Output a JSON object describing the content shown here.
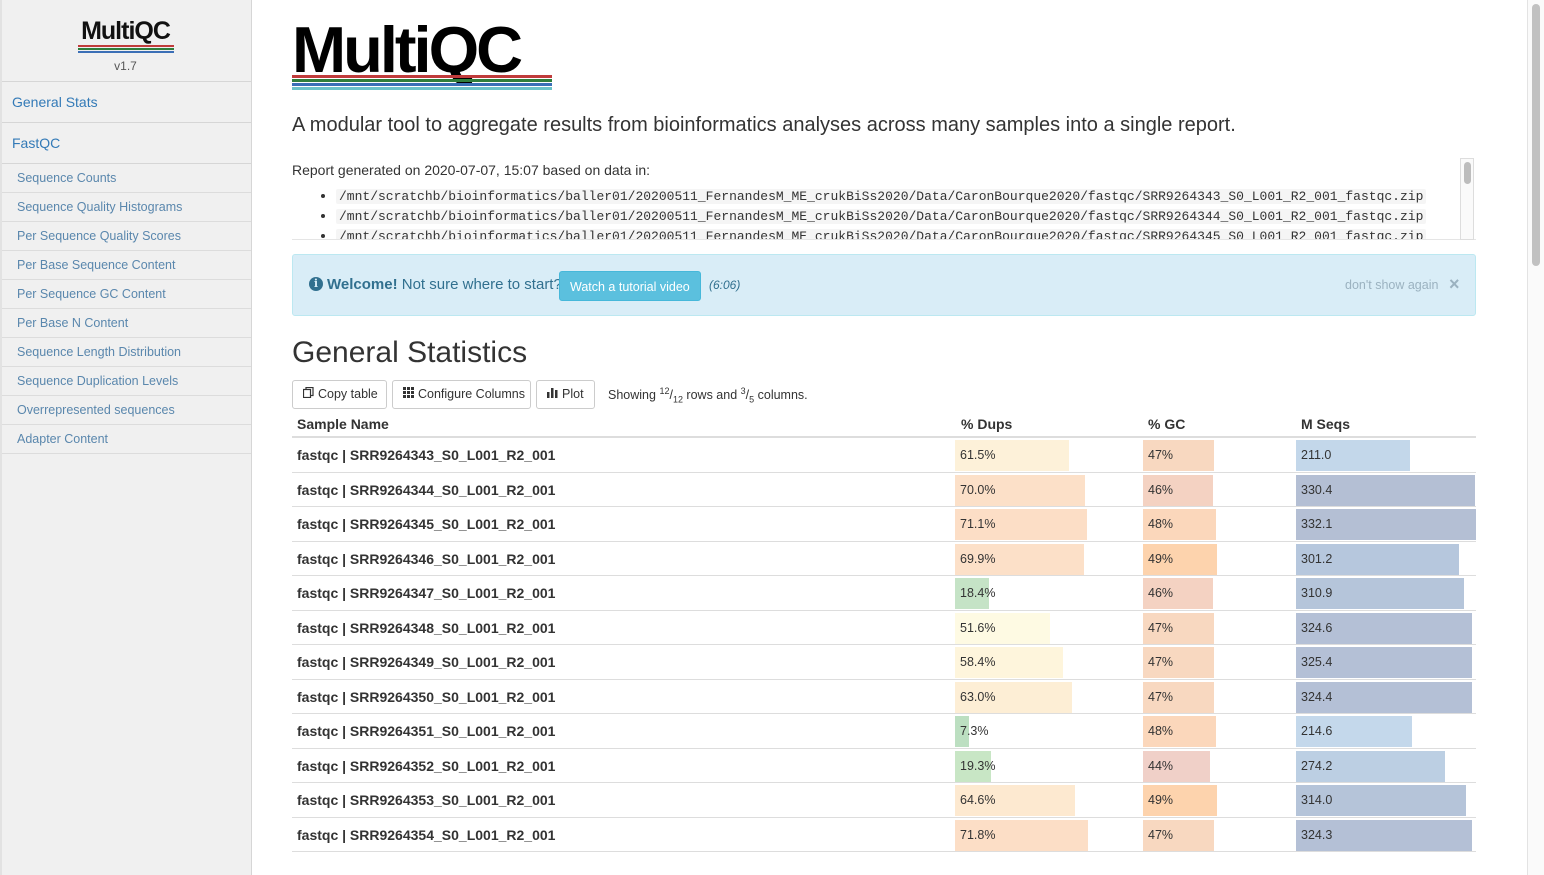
{
  "app": {
    "logo_text": "MultiQC",
    "version": "v1.7",
    "logo_line_colors": [
      "#c03b3b",
      "#2f7e3c",
      "#3b6fb6",
      "#6bc2c8"
    ]
  },
  "sidebar": {
    "general_stats": "General Stats",
    "fastqc": "FastQC",
    "fastqc_items": [
      "Sequence Counts",
      "Sequence Quality Histograms",
      "Per Sequence Quality Scores",
      "Per Base Sequence Content",
      "Per Sequence GC Content",
      "Per Base N Content",
      "Sequence Length Distribution",
      "Sequence Duplication Levels",
      "Overrepresented sequences",
      "Adapter Content"
    ]
  },
  "intro": {
    "tagline": "A modular tool to aggregate results from bioinformatics analyses across many samples into a single report.",
    "generated": "Report generated on 2020-07-07, 15:07 based on data in:",
    "files": [
      "/mnt/scratchb/bioinformatics/baller01/20200511_FernandesM_ME_crukBiSs2020/Data/CaronBourque2020/fastqc/SRR9264343_S0_L001_R2_001_fastqc.zip",
      "/mnt/scratchb/bioinformatics/baller01/20200511_FernandesM_ME_crukBiSs2020/Data/CaronBourque2020/fastqc/SRR9264344_S0_L001_R2_001_fastqc.zip",
      "/mnt/scratchb/bioinformatics/baller01/20200511_FernandesM_ME_crukBiSs2020/Data/CaronBourque2020/fastqc/SRR9264345_S0_L001_R2_001_fastqc.zip"
    ]
  },
  "welcome": {
    "info_icon": "i",
    "title": "Welcome!",
    "text": "Not sure where to start?",
    "button": "Watch a tutorial video",
    "duration": "(6:06)",
    "dismiss": "don't show again",
    "close": "×"
  },
  "general_stats": {
    "title": "General Statistics",
    "toolbar": {
      "copy": "Copy table",
      "configure": "Configure Columns",
      "plot": "Plot",
      "copy_icon": "copy-icon",
      "configure_icon": "grid-icon",
      "plot_icon": "bar-chart-icon"
    },
    "showing": {
      "prefix": "Showing ",
      "rows_shown": "12",
      "rows_total": "12",
      "mid": " rows and ",
      "cols_shown": "3",
      "cols_total": "5",
      "suffix": " columns."
    },
    "headers": {
      "name": "Sample Name",
      "dups": "% Dups",
      "gc": "% GC",
      "seqs": "M Seqs"
    },
    "rows": [
      {
        "name": "fastqc | SRR9264343_S0_L001_R2_001",
        "dups": "61.5%",
        "dups_frac": 0.615,
        "dups_color": "#fdf1d9",
        "gc": "47%",
        "gc_frac": 0.47,
        "gc_color": "#f8d8c0",
        "seqs": "211.0",
        "seqs_frac": 0.635,
        "seqs_color": "#c3d7ea"
      },
      {
        "name": "fastqc | SRR9264344_S0_L001_R2_001",
        "dups": "70.0%",
        "dups_frac": 0.7,
        "dups_color": "#fce0c8",
        "gc": "46%",
        "gc_frac": 0.46,
        "gc_color": "#f4d2c2",
        "seqs": "330.4",
        "seqs_frac": 0.995,
        "seqs_color": "#b4bfd4"
      },
      {
        "name": "fastqc | SRR9264345_S0_L001_R2_001",
        "dups": "71.1%",
        "dups_frac": 0.711,
        "dups_color": "#fcdec6",
        "gc": "48%",
        "gc_frac": 0.48,
        "gc_color": "#fbd7bb",
        "seqs": "332.1",
        "seqs_frac": 1.0,
        "seqs_color": "#b4bfd4"
      },
      {
        "name": "fastqc | SRR9264346_S0_L001_R2_001",
        "dups": "69.9%",
        "dups_frac": 0.699,
        "dups_color": "#fce0c8",
        "gc": "49%",
        "gc_frac": 0.49,
        "gc_color": "#fdd3ad",
        "seqs": "301.2",
        "seqs_frac": 0.907,
        "seqs_color": "#b6c7dd"
      },
      {
        "name": "fastqc | SRR9264347_S0_L001_R2_001",
        "dups": "18.4%",
        "dups_frac": 0.184,
        "dups_color": "#c5e3c6",
        "gc": "46%",
        "gc_frac": 0.46,
        "gc_color": "#f4d2c2",
        "seqs": "310.9",
        "seqs_frac": 0.936,
        "seqs_color": "#b5c5da"
      },
      {
        "name": "fastqc | SRR9264348_S0_L001_R2_001",
        "dups": "51.6%",
        "dups_frac": 0.516,
        "dups_color": "#fefae3",
        "gc": "47%",
        "gc_frac": 0.47,
        "gc_color": "#f8d8c0",
        "seqs": "324.6",
        "seqs_frac": 0.977,
        "seqs_color": "#b4c0d6"
      },
      {
        "name": "fastqc | SRR9264349_S0_L001_R2_001",
        "dups": "58.4%",
        "dups_frac": 0.584,
        "dups_color": "#fef5dc",
        "gc": "47%",
        "gc_frac": 0.47,
        "gc_color": "#f8d8c0",
        "seqs": "325.4",
        "seqs_frac": 0.98,
        "seqs_color": "#b4c0d6"
      },
      {
        "name": "fastqc | SRR9264350_S0_L001_R2_001",
        "dups": "63.0%",
        "dups_frac": 0.63,
        "dups_color": "#fdeed5",
        "gc": "47%",
        "gc_frac": 0.47,
        "gc_color": "#f8d8c0",
        "seqs": "324.4",
        "seqs_frac": 0.977,
        "seqs_color": "#b4c0d6"
      },
      {
        "name": "fastqc | SRR9264351_S0_L001_R2_001",
        "dups": "7.3%",
        "dups_frac": 0.073,
        "dups_color": "#bcdfc1",
        "gc": "48%",
        "gc_frac": 0.48,
        "gc_color": "#fbd7bb",
        "seqs": "214.6",
        "seqs_frac": 0.646,
        "seqs_color": "#c4d8eb"
      },
      {
        "name": "fastqc | SRR9264352_S0_L001_R2_001",
        "dups": "19.3%",
        "dups_frac": 0.193,
        "dups_color": "#c8e6c5",
        "gc": "44%",
        "gc_frac": 0.44,
        "gc_color": "#f0d0c8",
        "seqs": "274.2",
        "seqs_frac": 0.826,
        "seqs_color": "#bccfe3"
      },
      {
        "name": "fastqc | SRR9264353_S0_L001_R2_001",
        "dups": "64.6%",
        "dups_frac": 0.646,
        "dups_color": "#fde9d0",
        "gc": "49%",
        "gc_frac": 0.49,
        "gc_color": "#fdd3ad",
        "seqs": "314.0",
        "seqs_frac": 0.946,
        "seqs_color": "#b5c4d9"
      },
      {
        "name": "fastqc | SRR9264354_S0_L001_R2_001",
        "dups": "71.8%",
        "dups_frac": 0.718,
        "dups_color": "#fcdec6",
        "gc": "47%",
        "gc_frac": 0.47,
        "gc_color": "#f8d8c0",
        "seqs": "324.3",
        "seqs_frac": 0.977,
        "seqs_color": "#b4c0d6"
      }
    ]
  }
}
